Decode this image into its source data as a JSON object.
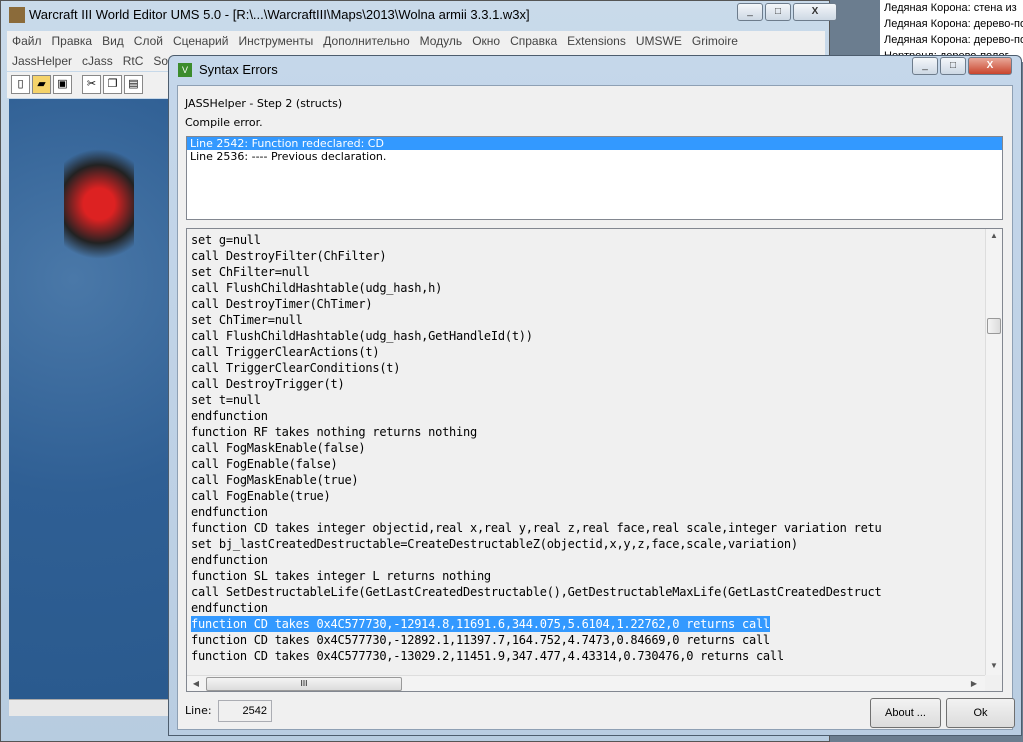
{
  "editor": {
    "title": "Warcraft III World Editor UMS 5.0 - [R:\\...\\WarcraftIII\\Maps\\2013\\Wolna armii 3.3.1.w3x]",
    "menu_row1": [
      "Файл",
      "Правка",
      "Вид",
      "Слой",
      "Сценарий",
      "Инструменты",
      "Дополнительно",
      "Модуль",
      "Окно",
      "Справка",
      "Extensions",
      "UMSWE",
      "Grimoire"
    ],
    "menu_row2": [
      "JassHelper",
      "cJass",
      "RtC",
      "So"
    ]
  },
  "right_panel": [
    "Ледяная Корона: стена из",
    "Ледяная Корона: дерево-по",
    "Ледяная Корона: дерево-по",
    "Нортренд: дерево-полог"
  ],
  "dialog": {
    "title": "Syntax Errors",
    "icon": "V",
    "step": "JASSHelper - Step 2 (structs)",
    "status": "Compile error.",
    "errors": [
      "Line 2542: Function redeclared: CD",
      "Line 2536: ---- Previous declaration."
    ],
    "selected_error": 0,
    "code": [
      "set g=null",
      "call DestroyFilter(ChFilter)",
      "set ChFilter=null",
      "call FlushChildHashtable(udg_hash,h)",
      "call DestroyTimer(ChTimer)",
      "set ChTimer=null",
      "call FlushChildHashtable(udg_hash,GetHandleId(t))",
      "call TriggerClearActions(t)",
      "call TriggerClearConditions(t)",
      "call DestroyTrigger(t)",
      "set t=null",
      "endfunction",
      "function RF takes nothing returns nothing",
      "call FogMaskEnable(false)",
      "call FogEnable(false)",
      "call FogMaskEnable(true)",
      "call FogEnable(true)",
      "endfunction",
      "function CD takes integer objectid,real x,real y,real z,real face,real scale,integer variation retu",
      "set bj_lastCreatedDestructable=CreateDestructableZ(objectid,x,y,z,face,scale,variation)",
      "endfunction",
      "function SL takes integer L returns nothing",
      "call SetDestructableLife(GetLastCreatedDestructable(),GetDestructableMaxLife(GetLastCreatedDestruct",
      "endfunction",
      "function CD takes 0x4C577730,-12914.8,11691.6,344.075,5.6104,1.22762,0 returns call",
      "function CD takes 0x4C577730,-12892.1,11397.7,164.752,4.7473,0.84669,0 returns call",
      "function CD takes 0x4C577730,-13029.2,11451.9,347.477,4.43314,0.730476,0 returns call"
    ],
    "selected_code_line": 24,
    "line_label": "Line:",
    "line_value": "2542",
    "about_label": "About ...",
    "ok_label": "Ok",
    "hscroll_grip": "III"
  }
}
